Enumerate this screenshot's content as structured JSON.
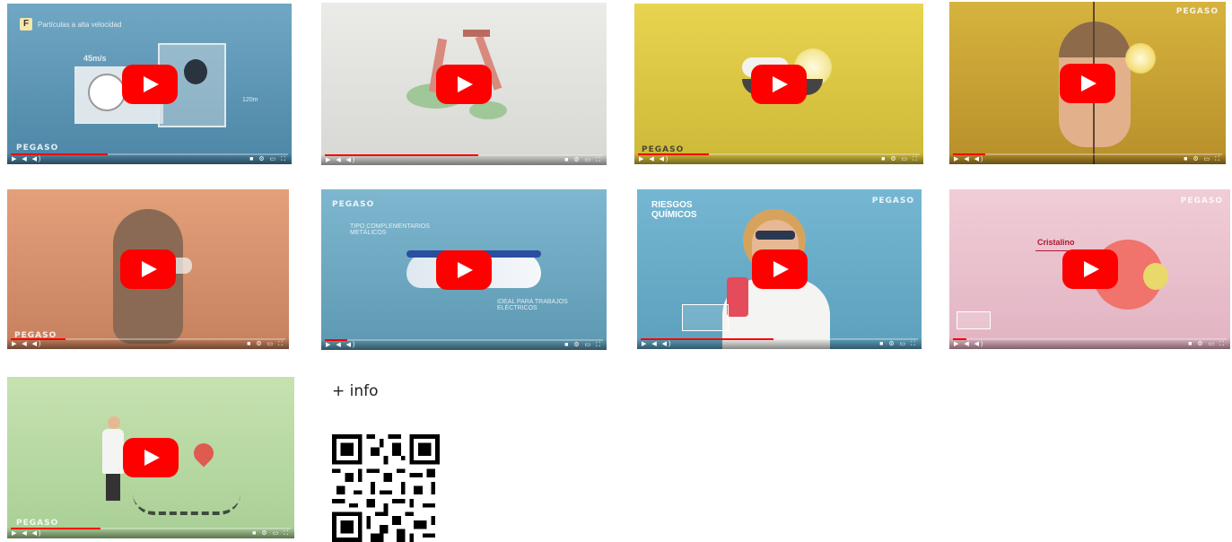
{
  "videos": [
    {
      "title_overlay": "Partículas a alta velocidad",
      "badge": "F",
      "speed_label": "45m/s",
      "mini_label": "120m",
      "brand": "PEGASO",
      "colors": {
        "bg_top": "#6fa7c4",
        "bg_bottom": "#4d86a6"
      },
      "progress": 0.35
    },
    {
      "brand": "",
      "colors": {
        "bg_top": "#ebebe8",
        "bg_bottom": "#d7d7d4"
      },
      "progress": 0.55
    },
    {
      "brand": "PEGASO",
      "colors": {
        "bg_top": "#e8d44f",
        "bg_bottom": "#cdb838"
      },
      "progress": 0.25
    },
    {
      "brand": "PEGASO",
      "colors": {
        "bg_top": "#d6b33e",
        "bg_bottom": "#b88f2a"
      },
      "progress": 0.12
    },
    {
      "brand": "PEGASO",
      "colors": {
        "bg_top": "#e3a07a",
        "bg_bottom": "#c6805e"
      },
      "progress": 0.2
    },
    {
      "brand": "PEGASO",
      "label_top": "TIPO COMPLEMENTARIOS METÁLICOS",
      "label_bottom": "IDEAL PARA TRABAJOS ELÉCTRICOS",
      "colors": {
        "bg_top": "#7eb7cf",
        "bg_bottom": "#5d98b2"
      },
      "progress": 0.08
    },
    {
      "brand": "PEGASO",
      "title_overlay": "RIESGOS QUÍMICOS",
      "colors": {
        "bg_top": "#75b7d2",
        "bg_bottom": "#5ca0bd"
      },
      "progress": 0.48
    },
    {
      "brand": "PEGASO",
      "title_overlay": "Cristalino",
      "colors": {
        "bg_top": "#f0cdd7",
        "bg_bottom": "#e2b3c2"
      },
      "progress": 0.05
    },
    {
      "brand": "PEGASO",
      "colors": {
        "bg_top": "#c6e2b0",
        "bg_bottom": "#a9cf95"
      },
      "progress": 0.32
    }
  ],
  "info_label": "+ info",
  "icons": {
    "play": "play-button-icon",
    "qr": "qr-code-icon"
  },
  "accent_color": "#ff0000"
}
